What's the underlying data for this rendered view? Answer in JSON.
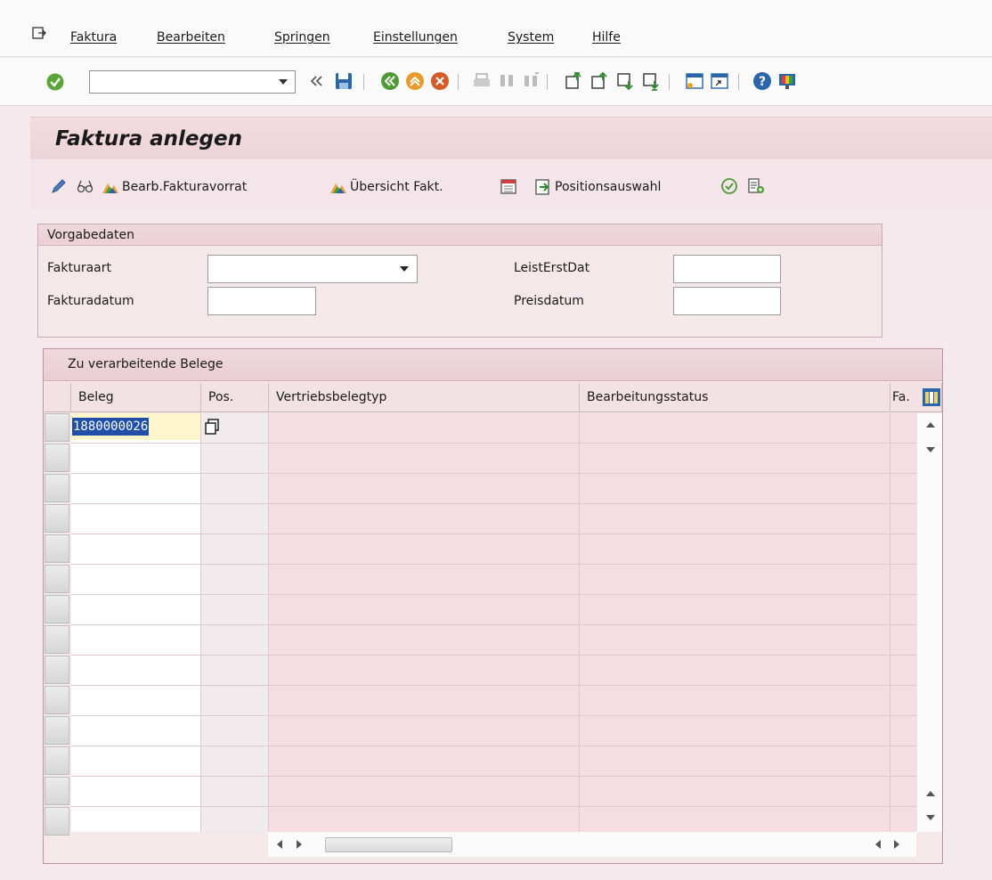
{
  "menubar": {
    "items": [
      "Faktura",
      "Bearbeiten",
      "Springen",
      "Einstellungen",
      "System",
      "Hilfe"
    ]
  },
  "toolbar": {
    "command_field_value": "",
    "icons": [
      "enter-icon",
      "back-double-icon",
      "save-icon",
      "back-icon",
      "exit-icon",
      "cancel-icon",
      "print-icon",
      "find-icon",
      "find-next-icon",
      "first-page-icon",
      "previous-page-icon",
      "next-page-icon",
      "last-page-icon",
      "new-session-icon",
      "shortcut-icon",
      "help-icon",
      "customize-layout-icon"
    ]
  },
  "page": {
    "title": "Faktura anlegen"
  },
  "app_toolbar": {
    "bearb_fakturavorrat": "Bearb.Fakturavorrat",
    "uebersicht_fakt": "Übersicht Fakt.",
    "positionsauswahl": "Positionsauswahl"
  },
  "vorgabedaten": {
    "heading": "Vorgabedaten",
    "fakturaart_label": "Fakturaart",
    "fakturaart_value": "",
    "fakturadatum_label": "Fakturadatum",
    "fakturadatum_value": "",
    "leisterstdat_label": "LeistErstDat",
    "leisterstdat_value": "",
    "preisdatum_label": "Preisdatum",
    "preisdatum_value": ""
  },
  "belege_table": {
    "title": "Zu verarbeitende Belege",
    "columns": [
      "Beleg",
      "Pos.",
      "Vertriebsbelegtyp",
      "Bearbeitungsstatus",
      "Fa."
    ],
    "rows": [
      {
        "beleg": "1880000026",
        "pos": "",
        "vertriebsbelegtyp": "",
        "bearbeitungsstatus": ""
      }
    ]
  },
  "colors": {
    "background": "#f4e9ec",
    "header": "#ecd3da",
    "selection": "#1f4fa8",
    "input_highlight": "#fdf6cc"
  }
}
